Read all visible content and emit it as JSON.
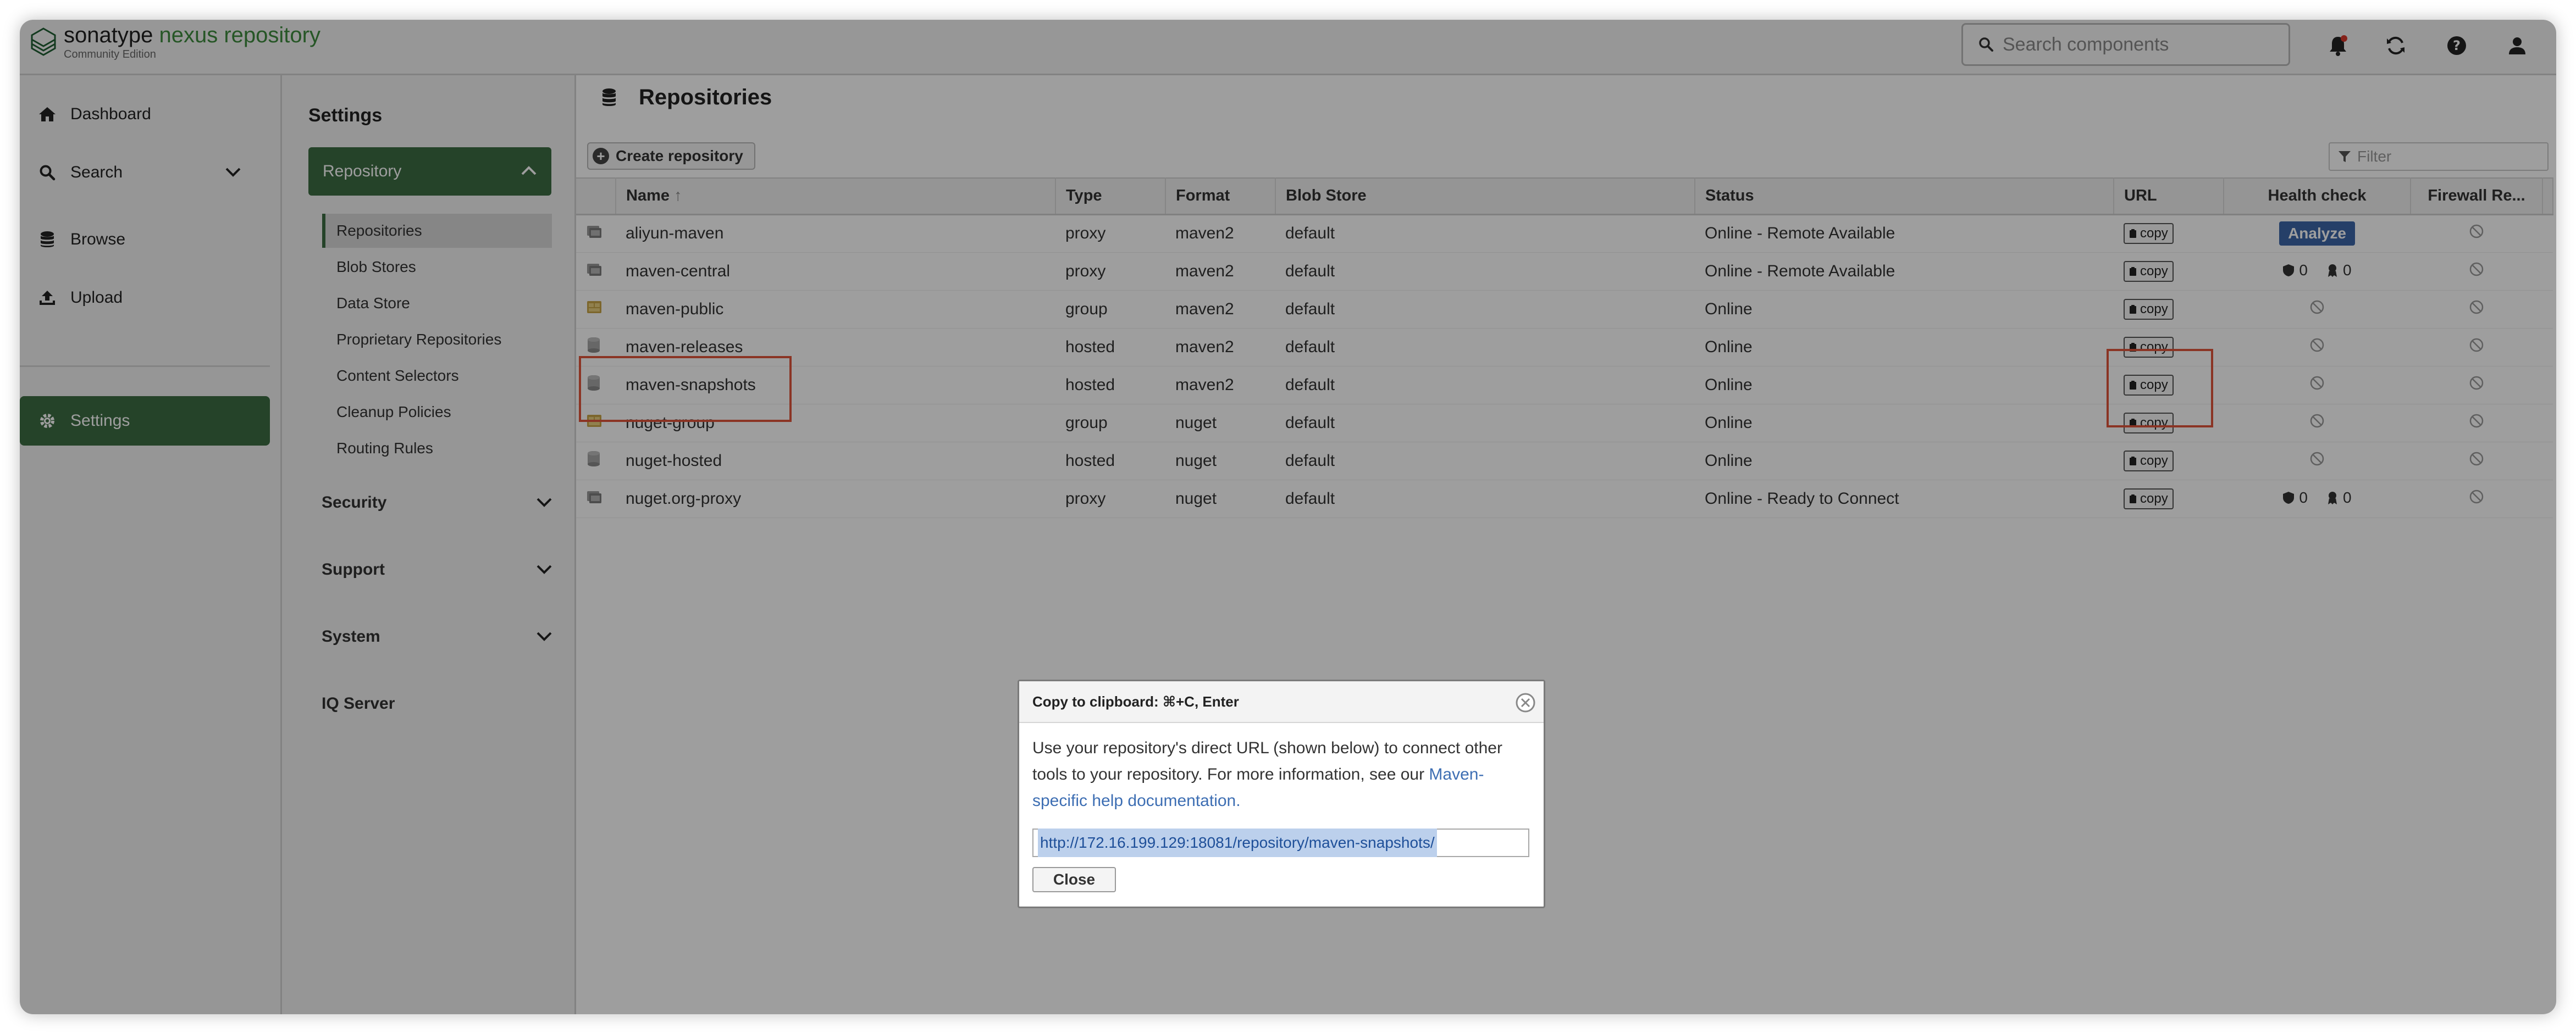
{
  "header": {
    "brand_prefix": "sonatype",
    "brand_suffix": "nexus repository",
    "edition": "Community Edition",
    "search_placeholder": "Search components"
  },
  "leftnav": {
    "items": [
      {
        "label": "Dashboard"
      },
      {
        "label": "Search"
      },
      {
        "label": "Browse"
      },
      {
        "label": "Upload"
      },
      {
        "label": "Settings"
      }
    ]
  },
  "subnav": {
    "title": "Settings",
    "group": "Repository",
    "items": [
      {
        "label": "Repositories"
      },
      {
        "label": "Blob Stores"
      },
      {
        "label": "Data Store"
      },
      {
        "label": "Proprietary Repositories"
      },
      {
        "label": "Content Selectors"
      },
      {
        "label": "Cleanup Policies"
      },
      {
        "label": "Routing Rules"
      }
    ],
    "sections": [
      {
        "label": "Security"
      },
      {
        "label": "Support"
      },
      {
        "label": "System"
      },
      {
        "label": "IQ Server"
      }
    ]
  },
  "main": {
    "title": "Repositories",
    "create_label": "Create repository",
    "filter_placeholder": "Filter",
    "columns": [
      "Name",
      "Type",
      "Format",
      "Blob Store",
      "Status",
      "URL",
      "Health check",
      "Firewall Re..."
    ],
    "sort_arrow": "↑",
    "copy_label": "copy",
    "analyze_label": "Analyze",
    "rows": [
      {
        "name": "aliyun-maven",
        "type": "proxy",
        "format": "maven2",
        "blob": "default",
        "status": "Online - Remote Available",
        "health": "analyze",
        "kind": "proxy"
      },
      {
        "name": "maven-central",
        "type": "proxy",
        "format": "maven2",
        "blob": "default",
        "status": "Online - Remote Available",
        "health": "counts",
        "h1": "0",
        "h2": "0",
        "kind": "proxy"
      },
      {
        "name": "maven-public",
        "type": "group",
        "format": "maven2",
        "blob": "default",
        "status": "Online",
        "health": "none",
        "kind": "group"
      },
      {
        "name": "maven-releases",
        "type": "hosted",
        "format": "maven2",
        "blob": "default",
        "status": "Online",
        "health": "none",
        "kind": "hosted"
      },
      {
        "name": "maven-snapshots",
        "type": "hosted",
        "format": "maven2",
        "blob": "default",
        "status": "Online",
        "health": "none",
        "kind": "hosted"
      },
      {
        "name": "nuget-group",
        "type": "group",
        "format": "nuget",
        "blob": "default",
        "status": "Online",
        "health": "none",
        "kind": "group"
      },
      {
        "name": "nuget-hosted",
        "type": "hosted",
        "format": "nuget",
        "blob": "default",
        "status": "Online",
        "health": "none",
        "kind": "hosted"
      },
      {
        "name": "nuget.org-proxy",
        "type": "proxy",
        "format": "nuget",
        "blob": "default",
        "status": "Online - Ready to Connect",
        "health": "counts",
        "h1": "0",
        "h2": "0",
        "kind": "proxy"
      }
    ]
  },
  "dialog": {
    "title": "Copy to clipboard: ⌘+C, Enter",
    "text_before": "Use your repository's direct URL (shown below) to connect other tools to your repository. For more information, see our ",
    "link_text": "Maven-specific help documentation.",
    "url": "http://172.16.199.129:18081/repository/maven-snapshots/",
    "close_label": "Close"
  },
  "colors": {
    "accent_green": "#3c6c43",
    "brand_green": "#3e8c3e",
    "analyze_blue": "#3c67a8",
    "highlight_red": "#e0543a",
    "link_blue": "#3d6eb3"
  }
}
